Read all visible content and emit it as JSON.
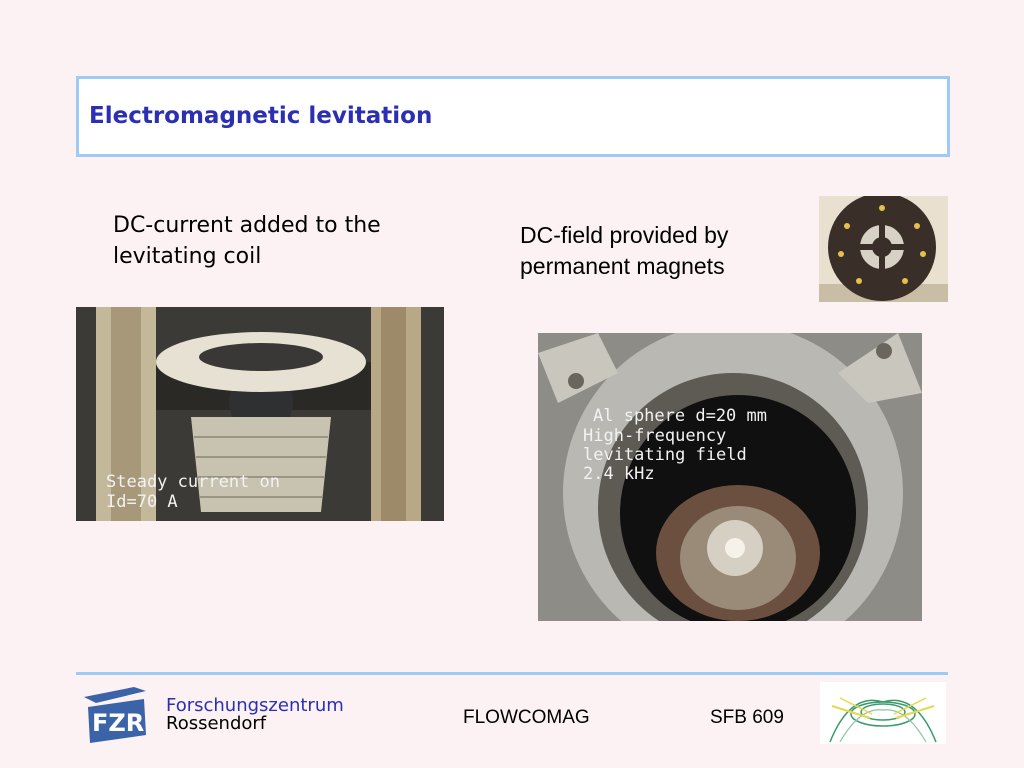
{
  "slide": {
    "title": "Electromagnetic levitation",
    "left_caption": "DC-current added to the levitating coil",
    "right_caption": "DC-field provided by permanent magnets"
  },
  "photos": {
    "coil_photo": {
      "overlay_line1": "Steady current on",
      "overlay_line2": "Id=70 A"
    },
    "sphere_photo": {
      "overlay_line1": "Al sphere d=20 mm",
      "overlay_line2": "High-frequency",
      "overlay_line3": "levitating field",
      "overlay_line4": "2.4 kHz"
    }
  },
  "footer": {
    "org_line1": "Forschungszentrum",
    "org_line2": "Rossendorf",
    "project": "FLOWCOMAG",
    "sfb": "SFB 609"
  },
  "colors": {
    "background": "#fcf2f4",
    "accent_blue": "#9ecbf5",
    "title_color": "#2a2fb3"
  },
  "icons": [
    "fzr-logo-icon",
    "sfb-logo-icon"
  ]
}
